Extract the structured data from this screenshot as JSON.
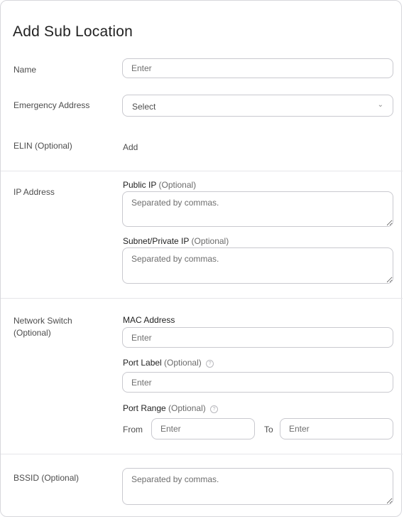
{
  "dialog": {
    "title": "Add Sub Location"
  },
  "name": {
    "label": "Name",
    "placeholder": "Enter"
  },
  "emergency_address": {
    "label": "Emergency Address",
    "selected": "Select"
  },
  "elin": {
    "label": "ELIN (Optional)",
    "action": "Add"
  },
  "ip_address": {
    "label": "IP Address",
    "public_ip_label": "Public IP",
    "public_ip_optional": "(Optional)",
    "public_ip_placeholder": "Separated by commas.",
    "private_ip_label": "Subnet/Private IP",
    "private_ip_optional": "(Optional)",
    "private_ip_placeholder": "Separated by commas."
  },
  "network_switch": {
    "label_line1": "Network Switch",
    "label_line2": "(Optional)",
    "mac_label": "MAC Address",
    "mac_placeholder": "Enter",
    "port_label_label": "Port Label",
    "port_label_optional": "(Optional)",
    "port_label_placeholder": "Enter",
    "port_range_label": "Port Range",
    "port_range_optional": "(Optional)",
    "from_label": "From",
    "from_placeholder": "Enter",
    "to_label": "To",
    "to_placeholder": "Enter"
  },
  "bssid": {
    "label": "BSSID (Optional)",
    "placeholder": "Separated by commas."
  },
  "icons": {
    "help": "question-circle-icon",
    "dropdown": "chevron-down-icon"
  }
}
